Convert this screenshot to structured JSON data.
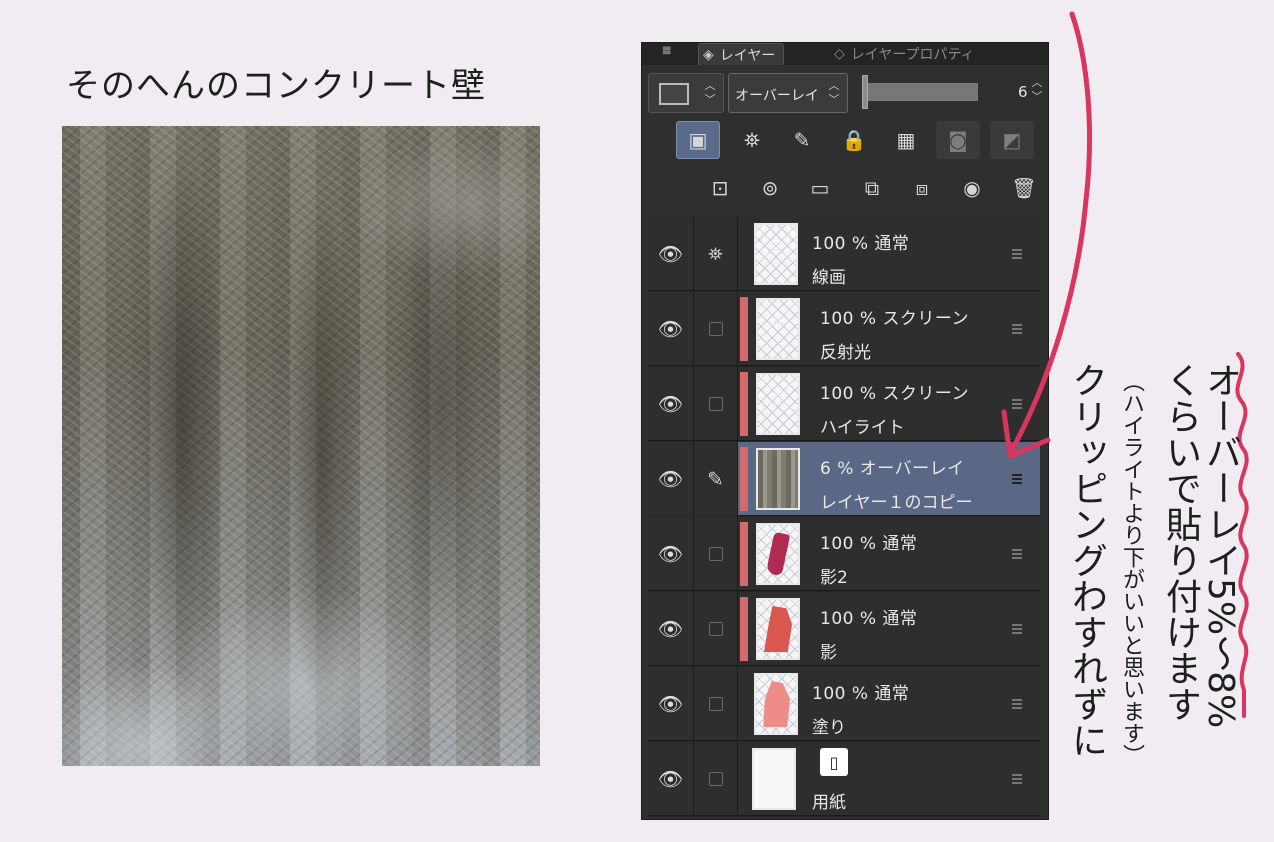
{
  "title": "そのへんのコンクリート壁",
  "panel": {
    "tabs": [
      {
        "label": "レイヤー",
        "icon": "layers-icon",
        "active": true
      },
      {
        "label": "レイヤープロパティ",
        "icon": "layer-property-icon",
        "active": false
      }
    ],
    "blend_mode": "オーバーレイ",
    "opacity_value": "6",
    "opacity_fraction": 0.06,
    "tool_row_1": [
      "clip-to-layer-below",
      "reference-layer",
      "draft-layer",
      "lock-layer",
      "lock-transparent",
      "mask-toggle",
      "ruler-toggle"
    ],
    "tool_row_2": [
      "new-raster-layer",
      "new-vector-layer",
      "new-folder",
      "transfer-down",
      "merge-down",
      "layer-mask",
      "delete"
    ]
  },
  "layers": [
    {
      "pct": "100 % 通常",
      "name": "線画",
      "clipped": false,
      "sub": "reference",
      "thumb": "pattern",
      "active": false
    },
    {
      "pct": "100 % スクリーン",
      "name": "反射光",
      "clipped": true,
      "sub": "checkbox",
      "thumb": "pattern",
      "active": false
    },
    {
      "pct": "100 % スクリーン",
      "name": "ハイライト",
      "clipped": true,
      "sub": "checkbox",
      "thumb": "pattern",
      "active": false
    },
    {
      "pct": "6 % オーバーレイ",
      "name": "レイヤー１のコピー",
      "clipped": true,
      "sub": "pen",
      "thumb": "concrete",
      "active": true
    },
    {
      "pct": "100 % 通常",
      "name": "影2",
      "clipped": true,
      "sub": "checkbox",
      "thumb": "shadow2",
      "active": false
    },
    {
      "pct": "100 % 通常",
      "name": "影",
      "clipped": true,
      "sub": "checkbox",
      "thumb": "shadow",
      "active": false
    },
    {
      "pct": "100 % 通常",
      "name": "塗り",
      "clipped": false,
      "sub": "checkbox",
      "thumb": "fill",
      "active": false
    },
    {
      "pct": "",
      "name": "用紙",
      "clipped": false,
      "sub": "checkbox",
      "thumb": "paper",
      "active": false
    }
  ],
  "annotation": {
    "line1": "オーバーレイ5%〜8%",
    "line2": "くらいで貼り付けます",
    "paren": "（ハイライトより下がいいと思います）",
    "line3": "クリッピングわすれずに",
    "accent_color": "#d8365f"
  }
}
